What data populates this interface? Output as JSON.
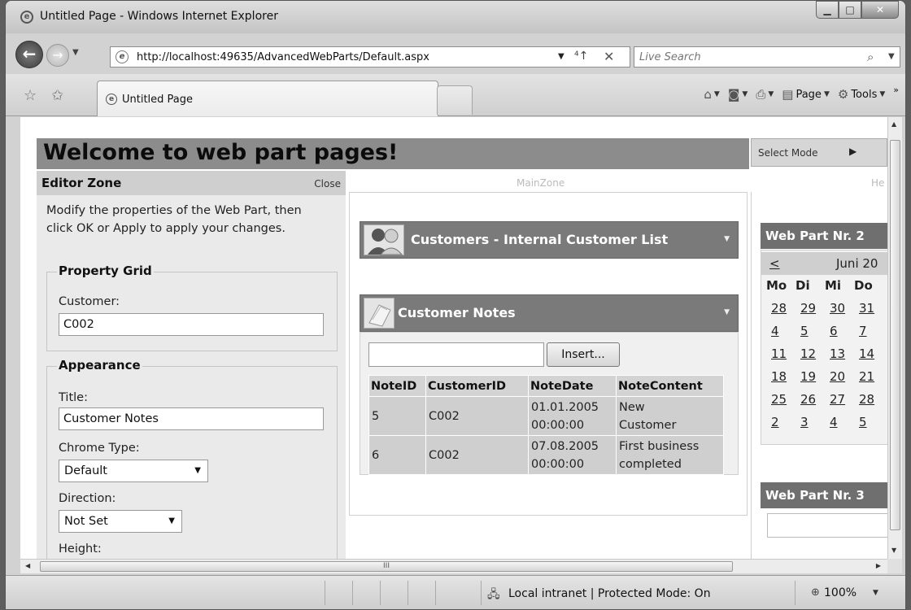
{
  "window": {
    "title": "Untitled Page - Windows Internet Explorer"
  },
  "address": {
    "url": "http://localhost:49635/AdvancedWebParts/Default.aspx"
  },
  "search": {
    "placeholder": "Live Search"
  },
  "tab": {
    "label": "Untitled Page"
  },
  "commandbar": {
    "page_label": "Page",
    "tools_label": "Tools",
    "chevron": "»"
  },
  "status": {
    "zone_text": "Local intranet | Protected Mode: On",
    "zoom": "100%"
  },
  "page": {
    "title": "Welcome to web part pages!",
    "mode_label": "Select Mode"
  },
  "editor": {
    "title": "Editor Zone",
    "close_label": "Close",
    "description": "Modify the properties of the Web Part, then click OK or Apply to apply your changes.",
    "property_grid": {
      "legend": "Property Grid",
      "customer_label": "Customer:",
      "customer_value": "C002"
    },
    "appearance": {
      "legend": "Appearance",
      "title_label": "Title:",
      "title_value": "Customer Notes",
      "chrome_type_label": "Chrome Type:",
      "chrome_type_value": "Default",
      "direction_label": "Direction:",
      "direction_value": "Not Set",
      "height_label": "Height:"
    }
  },
  "mainzone": {
    "label": "MainZone",
    "customers_title": "Customers - Internal Customer List",
    "notes_title": "Customer Notes",
    "insert_label": "Insert...",
    "notes_columns": [
      "NoteID",
      "CustomerID",
      "NoteDate",
      "NoteContent"
    ],
    "notes_rows": [
      {
        "id": "5",
        "customer": "C002",
        "date_line1": "01.01.2005",
        "date_line2": "00:00:00",
        "content_line1": "New",
        "content_line2": "Customer"
      },
      {
        "id": "6",
        "customer": "C002",
        "date_line1": "07.08.2005",
        "date_line2": "00:00:00",
        "content_line1": "First business",
        "content_line2": "completed"
      }
    ]
  },
  "rightzone": {
    "label": "He",
    "wp2_title": "Web Part Nr. 2",
    "wp3_title": "Web Part Nr. 3",
    "calendar": {
      "prev": "<",
      "month": "Juni 20",
      "weekdays": [
        "Mo",
        "Di",
        "Mi",
        "Do"
      ],
      "weeks": [
        [
          "28",
          "29",
          "30",
          "31"
        ],
        [
          "4",
          "5",
          "6",
          "7"
        ],
        [
          "11",
          "12",
          "13",
          "14"
        ],
        [
          "18",
          "19",
          "20",
          "21"
        ],
        [
          "25",
          "26",
          "27",
          "28"
        ],
        [
          "2",
          "3",
          "4",
          "5"
        ]
      ]
    }
  },
  "scrollbar": {
    "hscroll_grip": "III"
  }
}
